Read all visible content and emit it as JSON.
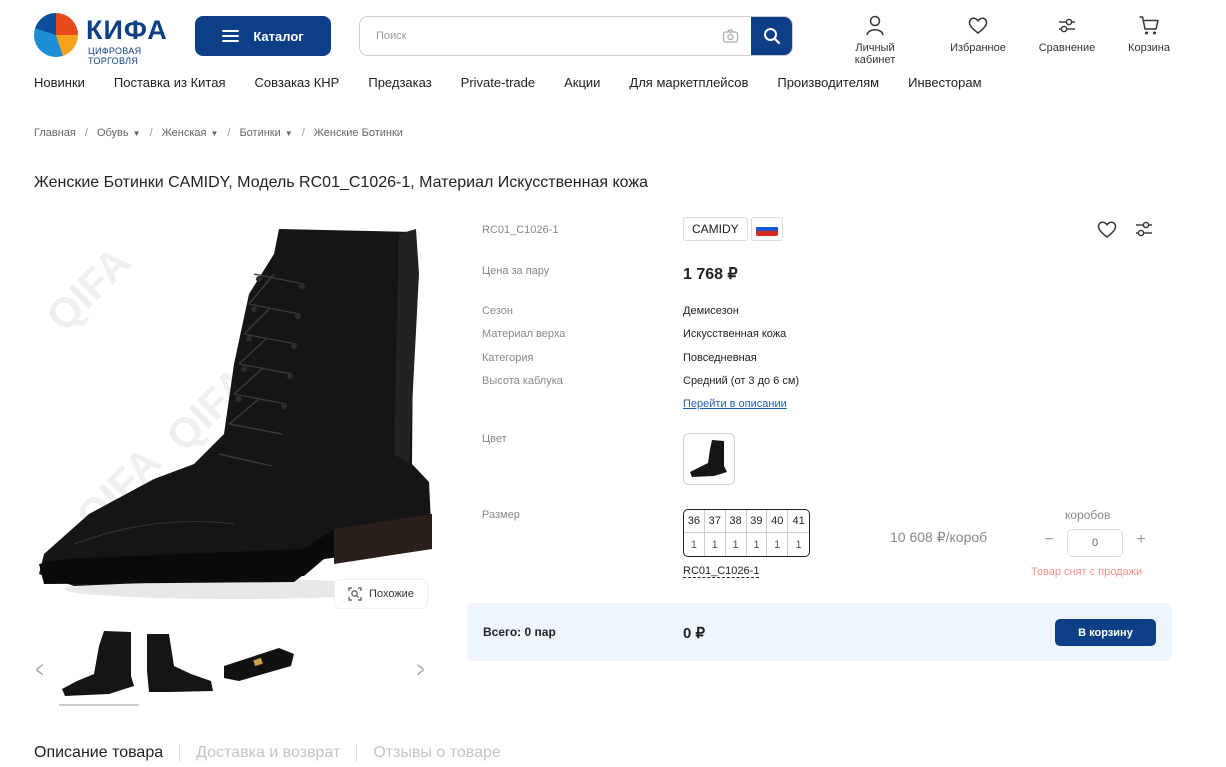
{
  "header": {
    "logo_text": "КИФА",
    "logo_sub": "ЦИФРОВАЯ ТОРГОВЛЯ",
    "catalog_label": "Каталог",
    "search_placeholder": "Поиск",
    "icons": [
      {
        "icon": "user-icon",
        "label": "Личный кабинет"
      },
      {
        "icon": "heart-icon",
        "label": "Избранное"
      },
      {
        "icon": "compare-icon",
        "label": "Сравнение"
      },
      {
        "icon": "cart-icon",
        "label": "Корзина"
      }
    ]
  },
  "nav": [
    "Новинки",
    "Поставка из Китая",
    "Совзаказ КНР",
    "Предзаказ",
    "Private-trade",
    "Акции",
    "Для маркетплейсов",
    "Производителям",
    "Инвесторам"
  ],
  "breadcrumbs": [
    "Главная",
    "Обувь",
    "Женская",
    "Ботинки",
    "Женские Ботинки"
  ],
  "product": {
    "title": "Женские Ботинки CAMIDY, Модель RC01_C1026-1, Материал Искусственная кожа",
    "sku": "RC01_C1026-1",
    "brand": "CAMIDY",
    "price_label": "Цена за пару",
    "price": "1 768 ₽",
    "specs": [
      {
        "label": "Сезон",
        "value": "Демисезон"
      },
      {
        "label": "Материал верха",
        "value": "Искусственная кожа"
      },
      {
        "label": "Категория",
        "value": "Повседневная"
      },
      {
        "label": "Высота каблука",
        "value": "Средний (от 3 до 6 см)"
      }
    ],
    "more_link": "Перейти в описании",
    "color_label": "Цвет",
    "size_label": "Размер",
    "sizes": [
      "36",
      "37",
      "38",
      "39",
      "40",
      "41"
    ],
    "quantities": [
      "1",
      "1",
      "1",
      "1",
      "1",
      "1"
    ],
    "model_link": "RC01_C1026-1",
    "box_price": "10 608 ₽/короб",
    "box_label": "коробов",
    "qty": "0",
    "minus": "−",
    "plus": "+",
    "status": "Товар снят с продажи",
    "similar_label": "Похожие"
  },
  "summary": {
    "total_label": "Всего: 0 пар",
    "total_value": "0 ₽",
    "cart_button": "В корзину"
  },
  "tabs": [
    "Описание товара",
    "Доставка и возврат",
    "Отзывы о товаре"
  ],
  "colors": {
    "brand_blue": "#0d3f86",
    "link": "#1d5fb8",
    "status": "#f3908c",
    "summary_bg": "#eef5fc"
  }
}
